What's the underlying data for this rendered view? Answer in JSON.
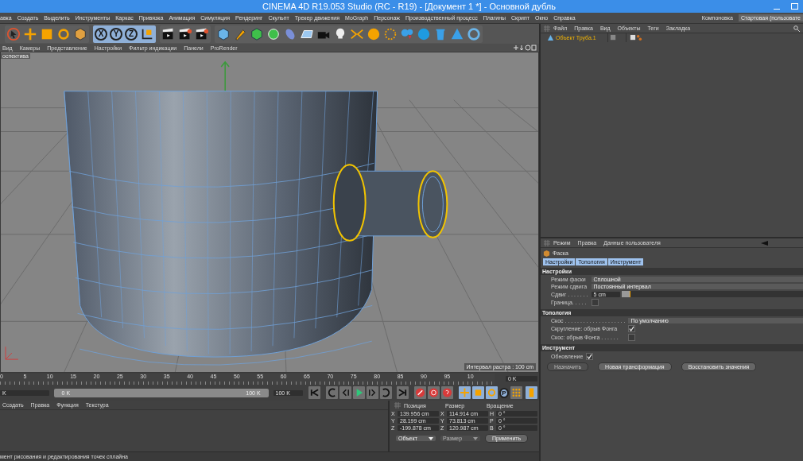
{
  "title_bar": {
    "title": "CINEMA 4D R19.053 Studio (RC - R19) - [Документ 1 *] - Основной дубль"
  },
  "menu_bar": {
    "items": [
      "авка",
      "Создать",
      "Выделить",
      "Инструменты",
      "Каркас",
      "Привязка",
      "Анимация",
      "Симуляция",
      "Рендеринг",
      "Скульпт",
      "Трекер движения",
      "MoGraph",
      "Персонаж",
      "Производственный процесс",
      "Плагины",
      "Скрипт",
      "Окно",
      "Справка"
    ],
    "layout_label": "Компоновка",
    "layout_value": "Стартовая (пользовате"
  },
  "toolbar": {
    "axis_buttons": [
      "X",
      "Y",
      "Z"
    ]
  },
  "viewport": {
    "menu": [
      "Вид",
      "Камеры",
      "Представление",
      "Настройки",
      "Фильтр индикации",
      "Панели",
      "ProRender"
    ],
    "camera_label": "оспектива",
    "grid_spacing": "Интервал растра : 100 cm"
  },
  "timeline": {
    "ticks": [
      "0",
      "5",
      "10",
      "15",
      "20",
      "25",
      "30",
      "35",
      "40",
      "45",
      "50",
      "55",
      "60",
      "65",
      "70",
      "75",
      "80",
      "85",
      "90",
      "95",
      "10"
    ],
    "current_frame": "0 K"
  },
  "transport": {
    "start_field": "K",
    "range_bar": {
      "start": "0 K",
      "end": "100 K"
    },
    "end_field": "100 K",
    "param_key": "P"
  },
  "material_manager": {
    "menu": [
      "Создать",
      "Правка",
      "Функция",
      "Текстура"
    ]
  },
  "coordinates": {
    "headers": [
      "Позиция",
      "Размер",
      "Вращение"
    ],
    "rows": [
      {
        "pos_axis": "X",
        "position": "139.956 cm",
        "size_axis": "X",
        "size": "114.914 cm",
        "rot_axis": "H",
        "rotation": "0 °"
      },
      {
        "pos_axis": "Y",
        "position": "28.199 cm",
        "size_axis": "Y",
        "size": "73.813 cm",
        "rot_axis": "P",
        "rotation": "0 °"
      },
      {
        "pos_axis": "Z",
        "position": "-199.878 cm",
        "size_axis": "Z",
        "size": "120.987 cm",
        "rot_axis": "B",
        "rotation": "0 °"
      }
    ],
    "mode": {
      "label": "Объект",
      "disabled": false
    },
    "size_mode": {
      "label": "Размер",
      "disabled": true
    },
    "apply": "Применить"
  },
  "status_bar": {
    "text": "мент рисования и редактирования точек сплайна"
  },
  "object_manager": {
    "menu": [
      "Файл",
      "Правка",
      "Вид",
      "Объекты",
      "Теги",
      "Закладка"
    ],
    "objects": [
      {
        "name": "Объект Труба.1",
        "selected": true
      }
    ]
  },
  "attribute_manager": {
    "menu": [
      "Режим",
      "Правка",
      "Данные пользователя"
    ],
    "tool": "Фаска",
    "tabs": [
      {
        "label": "Настройки",
        "selected": true
      },
      {
        "label": "Топология",
        "selected": true
      },
      {
        "label": "Инструмент",
        "selected": true
      }
    ],
    "sections": [
      {
        "title": "Настройки",
        "fields": [
          {
            "kind": "dropdown",
            "label": "Режим фаски",
            "value": "Сплошной"
          },
          {
            "kind": "dropdown",
            "label": "Режим сдвига",
            "value": "Постоянный интервал"
          },
          {
            "kind": "slider",
            "label": "Сдвиг . . . . . . .",
            "value": "5 cm",
            "level": 0.05
          },
          {
            "kind": "checkbox",
            "label": "Граница. . . . .",
            "checked": false
          }
        ]
      },
      {
        "title": "Топология",
        "fields": [
          {
            "kind": "dropdown",
            "label": "Скос . . . . . . . . . . . . . . . . . . . .",
            "value": "По умолчанию"
          },
          {
            "kind": "checkbox",
            "label": "Скругление: обрыв Фонга",
            "checked": true
          },
          {
            "kind": "checkbox",
            "label": "Скос: обрыв Фонга . . . . . .",
            "checked": false
          }
        ]
      },
      {
        "title": "Инструмент",
        "fields": [
          {
            "kind": "checkbox",
            "label": "Обновление",
            "checked": true
          }
        ]
      }
    ],
    "buttons": [
      {
        "label": "Назначить",
        "disabled": true
      },
      {
        "label": "Новая трансформация",
        "disabled": false
      },
      {
        "label": "Восстановить значения",
        "disabled": false
      }
    ]
  }
}
